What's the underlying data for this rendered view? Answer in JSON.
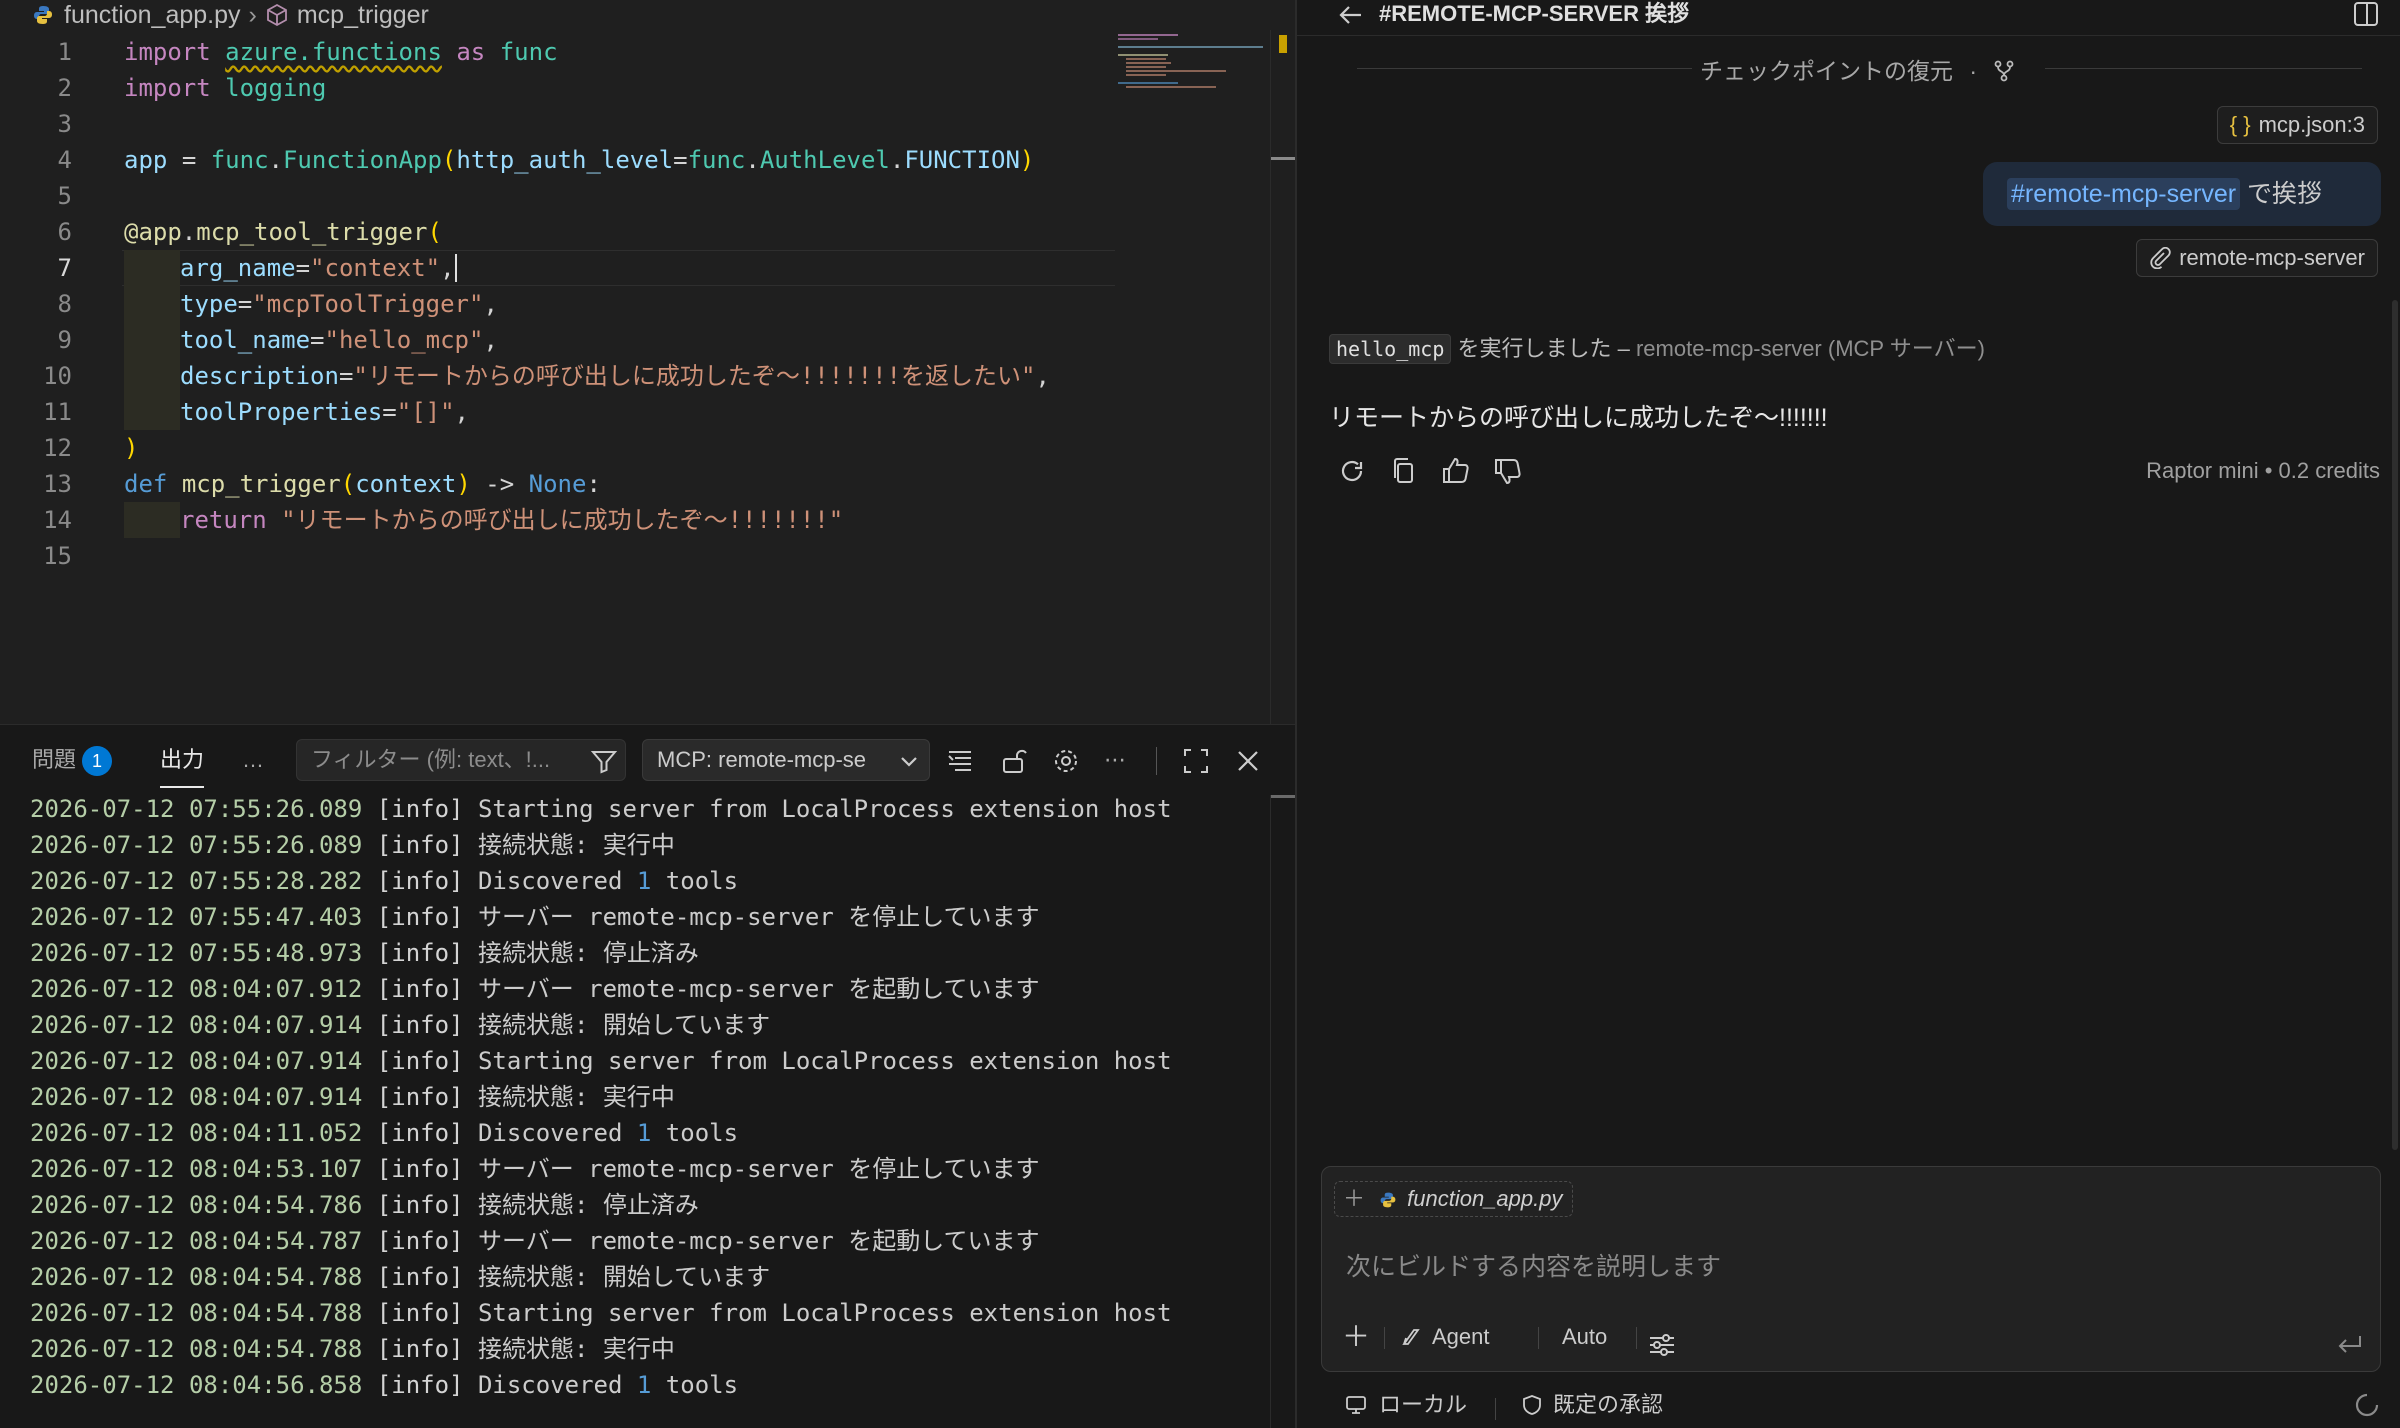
{
  "editor": {
    "breadcrumb": {
      "file": "function_app.py",
      "symbol": "mcp_trigger"
    },
    "current_line": 7
  },
  "panel": {
    "tabs": {
      "problems": "問題",
      "problems_count": "1",
      "output": "出力",
      "more": "…"
    },
    "filter_placeholder": "フィルター (例: text、!...",
    "channel": "MCP: remote-mcp-se",
    "log": [
      {
        "ts": "2026-07-12 07:55:26.089",
        "level": "[info]",
        "msg": "Starting server from LocalProcess extension host"
      },
      {
        "ts": "2026-07-12 07:55:26.089",
        "level": "[info]",
        "msg": "接続状態: 実行中"
      },
      {
        "ts": "2026-07-12 07:55:28.282",
        "level": "[info]",
        "msg": "Discovered 1 tools"
      },
      {
        "ts": "2026-07-12 07:55:47.403",
        "level": "[info]",
        "msg": "サーバー remote-mcp-server を停止しています"
      },
      {
        "ts": "2026-07-12 07:55:48.973",
        "level": "[info]",
        "msg": "接続状態: 停止済み"
      },
      {
        "ts": "2026-07-12 08:04:07.912",
        "level": "[info]",
        "msg": "サーバー remote-mcp-server を起動しています"
      },
      {
        "ts": "2026-07-12 08:04:07.914",
        "level": "[info]",
        "msg": "接続状態: 開始しています"
      },
      {
        "ts": "2026-07-12 08:04:07.914",
        "level": "[info]",
        "msg": "Starting server from LocalProcess extension host"
      },
      {
        "ts": "2026-07-12 08:04:07.914",
        "level": "[info]",
        "msg": "接続状態: 実行中"
      },
      {
        "ts": "2026-07-12 08:04:11.052",
        "level": "[info]",
        "msg": "Discovered 1 tools"
      },
      {
        "ts": "2026-07-12 08:04:53.107",
        "level": "[info]",
        "msg": "サーバー remote-mcp-server を停止しています"
      },
      {
        "ts": "2026-07-12 08:04:54.786",
        "level": "[info]",
        "msg": "接続状態: 停止済み"
      },
      {
        "ts": "2026-07-12 08:04:54.787",
        "level": "[info]",
        "msg": "サーバー remote-mcp-server を起動しています"
      },
      {
        "ts": "2026-07-12 08:04:54.788",
        "level": "[info]",
        "msg": "接続状態: 開始しています"
      },
      {
        "ts": "2026-07-12 08:04:54.788",
        "level": "[info]",
        "msg": "Starting server from LocalProcess extension host"
      },
      {
        "ts": "2026-07-12 08:04:54.788",
        "level": "[info]",
        "msg": "接続状態: 実行中"
      },
      {
        "ts": "2026-07-12 08:04:56.858",
        "level": "[info]",
        "msg": "Discovered 1 tools"
      }
    ]
  },
  "chat": {
    "title": "#REMOTE-MCP-SERVER 挨拶",
    "checkpoint": "チェックポイントの復元",
    "checkpoint_sep": "·",
    "context_pill": "mcp.json:3",
    "context_pill_icon": "{ }",
    "user_message": {
      "ref": "#remote-mcp-server",
      "text": " で挨拶"
    },
    "attachment": "remote-mcp-server",
    "tool_run": {
      "tool": "hello_mcp",
      "text": " を実行しました – ",
      "source": "remote-mcp-server (MCP サーバー)"
    },
    "answer": "リモートからの呼び出しに成功したぞ〜!!!!!!!",
    "model_info": "Raptor mini • 0.2 credits",
    "input": {
      "context_file": "function_app.py",
      "placeholder": "次にビルドする内容を説明します",
      "agent": "Agent",
      "auto": "Auto"
    },
    "footer": {
      "local": "ローカル",
      "approval": "既定の承認"
    }
  },
  "colors": {
    "accent": "#0078d4",
    "link": "#75b6ff",
    "bg": "#1f1f1f",
    "panel_bg": "#181818"
  }
}
